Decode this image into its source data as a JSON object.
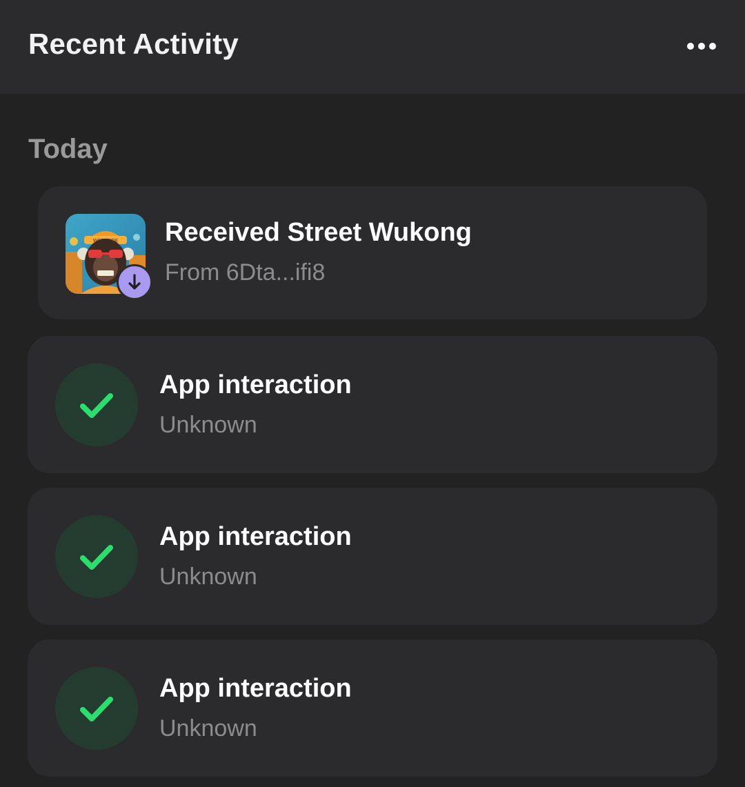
{
  "header": {
    "title": "Recent Activity",
    "more_icon": "more-horizontal-icon"
  },
  "section": {
    "title": "Today"
  },
  "activities": [
    {
      "title": "Received Street Wukong",
      "subtitle": "From 6Dta...ifi8",
      "image": "nft-thumbnail",
      "badge_icon": "arrow-down-icon",
      "badge_color": "#a99af0"
    },
    {
      "title": "App interaction",
      "subtitle": "Unknown",
      "icon": "checkmark-icon",
      "icon_color": "#2fdc6f"
    },
    {
      "title": "App interaction",
      "subtitle": "Unknown",
      "icon": "checkmark-icon",
      "icon_color": "#2fdc6f"
    },
    {
      "title": "App interaction",
      "subtitle": "Unknown",
      "icon": "checkmark-icon",
      "icon_color": "#2fdc6f"
    }
  ],
  "colors": {
    "background": "#222222",
    "card": "#2b2b2e",
    "title_text": "#ffffff",
    "subtitle_text": "#8c8c8c",
    "section_text": "#9a9a9a",
    "success_green": "#2fdc6f",
    "success_bg": "#243c2f"
  }
}
